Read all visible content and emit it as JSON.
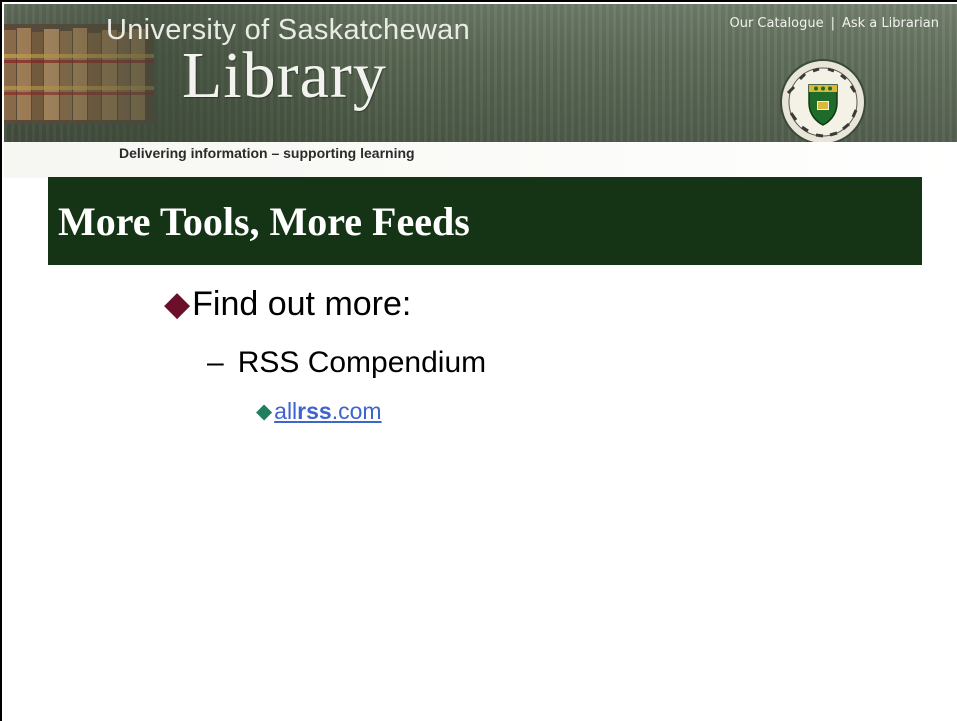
{
  "header": {
    "university_name": "University of Saskatchewan",
    "library_word": "Library",
    "tagline": "Delivering information – supporting learning",
    "links": [
      {
        "label": "Our Catalogue"
      },
      {
        "label": "Ask a Librarian"
      }
    ],
    "link_separator": "|"
  },
  "slide": {
    "title": "More Tools, More Feeds",
    "bullet_level1": "Find out more:",
    "bullet_level2_marker": "–",
    "bullet_level2": "RSS Compendium",
    "bullet_level3_link": {
      "prefix": "all",
      "bold": "rss",
      "suffix": ".com"
    }
  },
  "icons": {
    "level1_bullet": "diamond-bullet-icon",
    "level3_bullet": "small-diamond-bullet-icon",
    "crest": "university-crest-icon"
  },
  "colors": {
    "title_bar": "#153315",
    "level1_bullet": "#6b0f2b",
    "level3_bullet": "#1f7f5f",
    "link": "#3d64cf"
  }
}
